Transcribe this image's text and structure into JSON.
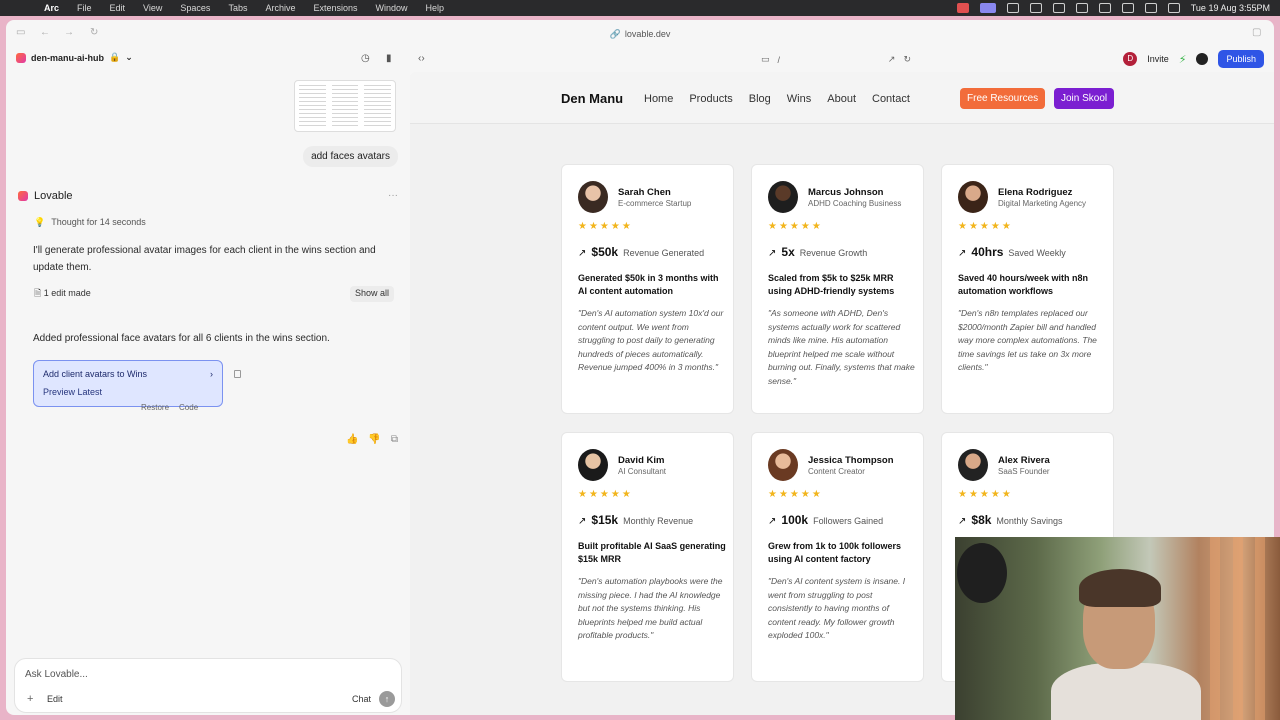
{
  "menubar": {
    "app": "Arc",
    "items": [
      "File",
      "Edit",
      "View",
      "Spaces",
      "Tabs",
      "Archive",
      "Extensions",
      "Window",
      "Help"
    ],
    "clock": "Tue 19 Aug  3:55PM"
  },
  "browser": {
    "url": "lovable.dev"
  },
  "topbar": {
    "project": "den-manu-ai-hub",
    "path": "/",
    "avatar_initial": "D",
    "invite": "Invite",
    "publish": "Publish"
  },
  "chat": {
    "user_message": "add faces avatars",
    "assistant_name": "Lovable",
    "thought": "Thought for 14 seconds",
    "response": "I'll generate professional avatar images for each client in the wins section and update them.",
    "edits_label": "1 edit made",
    "show_all": "Show all",
    "summary": "Added professional face avatars for all 6 clients in the wins section.",
    "card_title": "Add client avatars to Wins",
    "card_sub": "Preview Latest",
    "restore": "Restore",
    "code": "Code",
    "input_placeholder": "Ask Lovable...",
    "edit_btn": "Edit",
    "chat_btn": "Chat"
  },
  "site": {
    "brand": "Den Manu",
    "nav": [
      "Home",
      "Products",
      "Blog",
      "Wins",
      "About",
      "Contact"
    ],
    "free_btn": "Free Resources",
    "skool_btn": "Join Skool",
    "stars": "★★★★★",
    "testimonials": [
      {
        "name": "Sarah Chen",
        "role": "E-commerce Startup",
        "value": "$50k",
        "label": "Revenue Generated",
        "headline": "Generated $50k in 3 months with AI content automation",
        "quote": "\"Den's AI automation system 10x'd our content output. We went from struggling to post daily to generating hundreds of pieces automatically. Revenue jumped 400% in 3 months.\""
      },
      {
        "name": "Marcus Johnson",
        "role": "ADHD Coaching Business",
        "value": "5x",
        "label": "Revenue Growth",
        "headline": "Scaled from $5k to $25k MRR using ADHD-friendly systems",
        "quote": "\"As someone with ADHD, Den's systems actually work for scattered minds like mine. His automation blueprint helped me scale without burning out. Finally, systems that make sense.\""
      },
      {
        "name": "Elena Rodriguez",
        "role": "Digital Marketing Agency",
        "value": "40hrs",
        "label": "Saved Weekly",
        "headline": "Saved 40 hours/week with n8n automation workflows",
        "quote": "\"Den's n8n templates replaced our $2000/month Zapier bill and handled way more complex automations. The time savings let us take on 3x more clients.\""
      },
      {
        "name": "David Kim",
        "role": "AI Consultant",
        "value": "$15k",
        "label": "Monthly Revenue",
        "headline": "Built profitable AI SaaS generating $15k MRR",
        "quote": "\"Den's automation playbooks were the missing piece. I had the AI knowledge but not the systems thinking. His blueprints helped me build actual profitable products.\""
      },
      {
        "name": "Jessica Thompson",
        "role": "Content Creator",
        "value": "100k",
        "label": "Followers Gained",
        "headline": "Grew from 1k to 100k followers using AI content factory",
        "quote": "\"Den's AI content system is insane. I went from struggling to post consistently to having months of content ready. My follower growth exploded 100x.\""
      },
      {
        "name": "Alex Rivera",
        "role": "SaaS Founder",
        "value": "$8k",
        "label": "Monthly Savings",
        "headline": "",
        "quote": ""
      }
    ]
  },
  "colors": {
    "accent_blue": "#2f55e6",
    "orange": "#f26c3a",
    "purple": "#7b1fd1",
    "star": "#f2b51c"
  }
}
